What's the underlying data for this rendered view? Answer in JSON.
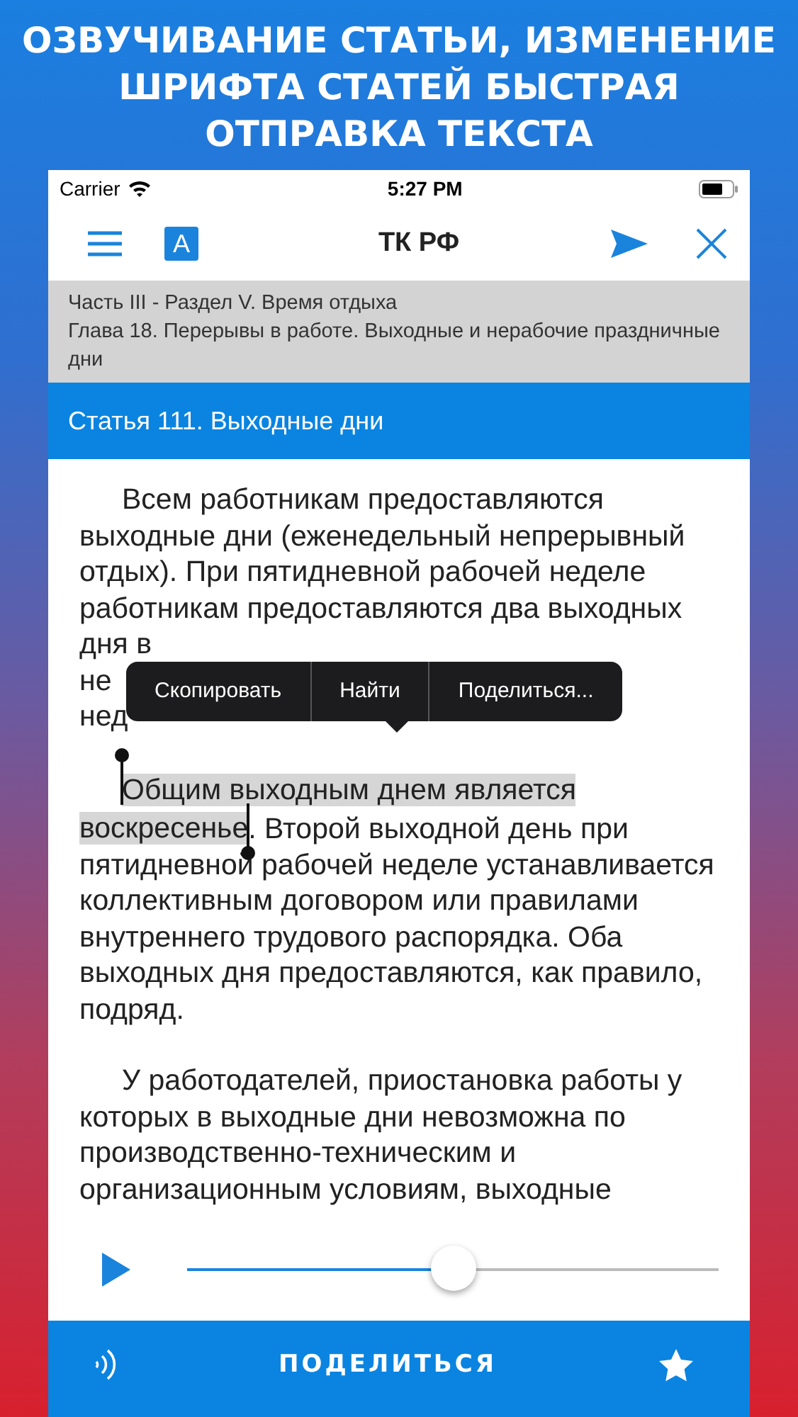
{
  "promo_title": "ОЗВУЧИВАНИЕ СТАТЬИ, ИЗМЕНЕНИЕ ШРИФТА СТАТЕЙ БЫСТРАЯ ОТПРАВКА ТЕКСТА",
  "status_bar": {
    "carrier": "Carrier",
    "time": "5:27 PM"
  },
  "nav": {
    "font_button": "A",
    "title": "ТК РФ"
  },
  "breadcrumb": [
    "Часть III - Раздел V. Время отдыха",
    "Глава 18. Перерывы в работе. Выходные и нерабочие праздничные дни"
  ],
  "article_title": "Статья 111. Выходные дни",
  "paragraph_1": "Всем работникам предоставляются выходные дни (еженедельный непрерывный отдых). При пятидневной рабочей неделе работникам предоставляются два выходных дня в",
  "covered_lines": [
    "не",
    "нед"
  ],
  "context_menu": [
    "Скопировать",
    "Найти",
    "Поделиться..."
  ],
  "paragraph_2": {
    "selected_text": "Общим выходным днем является воскресенье",
    "text": ". Второй выходной день при пятидневной рабочей неделе устанавливается коллективным договором или правилами внутреннего трудового распорядка. Оба выходных дня предоставляются, как правило, подряд."
  },
  "paragraph_3": "У работодателей, приостановка работы у которых в выходные дни невозможна по производственно-техническим и организационным условиям, выходные",
  "player": {
    "level": 0.5
  },
  "bottom_bar": {
    "share_button": "ПОДЕЛИТЬСЯ"
  }
}
